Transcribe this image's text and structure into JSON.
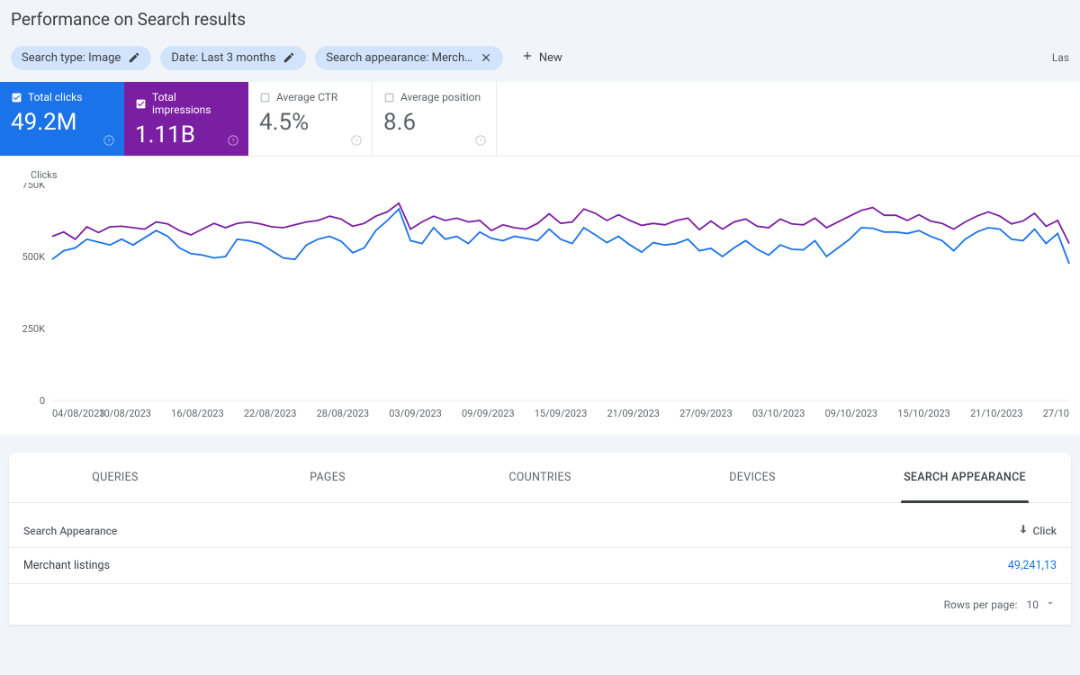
{
  "page_title": "Performance on Search results",
  "filters": {
    "search_type": "Search type: Image",
    "date": "Date: Last 3 months",
    "appearance": "Search appearance: Merch…",
    "new_label": "New"
  },
  "last_updated_fragment": "Las",
  "metrics": {
    "clicks": {
      "label": "Total clicks",
      "value": "49.2M"
    },
    "impressions": {
      "label": "Total impressions",
      "value": "1.11B"
    },
    "ctr": {
      "label": "Average CTR",
      "value": "4.5%"
    },
    "position": {
      "label": "Average position",
      "value": "8.6"
    }
  },
  "tabs": {
    "queries": "QUERIES",
    "pages": "PAGES",
    "countries": "COUNTRIES",
    "devices": "DEVICES",
    "search_appearance": "SEARCH APPEARANCE"
  },
  "table": {
    "header_name": "Search Appearance",
    "header_clicks": "Click",
    "row0_name": "Merchant listings",
    "row0_clicks": "49,241,13"
  },
  "pager": {
    "rows_label": "Rows per page:",
    "rows_value": "10"
  },
  "chart_data": {
    "type": "line",
    "ylabel": "Clicks",
    "ylim": [
      0,
      750000
    ],
    "yticks": [
      "0",
      "250K",
      "500K",
      "750K"
    ],
    "x_categories": [
      "04/08/2023",
      "10/08/2023",
      "16/08/2023",
      "22/08/2023",
      "28/08/2023",
      "03/09/2023",
      "09/09/2023",
      "15/09/2023",
      "21/09/2023",
      "27/09/2023",
      "03/10/2023",
      "09/10/2023",
      "15/10/2023",
      "21/10/2023",
      "27/10"
    ],
    "series": [
      {
        "name": "Total clicks",
        "color": "#1a73e8",
        "values": [
          490000,
          520000,
          530000,
          560000,
          550000,
          540000,
          560000,
          540000,
          565000,
          590000,
          570000,
          530000,
          510000,
          505000,
          495000,
          500000,
          560000,
          555000,
          545000,
          520000,
          495000,
          490000,
          540000,
          560000,
          570000,
          553000,
          513000,
          530000,
          590000,
          625000,
          665000,
          555000,
          545000,
          600000,
          560000,
          570000,
          545000,
          585000,
          563000,
          555000,
          570000,
          563000,
          555000,
          595000,
          560000,
          545000,
          600000,
          575000,
          548000,
          570000,
          540000,
          515000,
          548000,
          540000,
          545000,
          560000,
          520000,
          528000,
          500000,
          530000,
          555000,
          525000,
          505000,
          540000,
          525000,
          523000,
          555000,
          500000,
          530000,
          560000,
          600000,
          598000,
          585000,
          585000,
          580000,
          590000,
          570000,
          555000,
          520000,
          560000,
          585000,
          600000,
          595000,
          560000,
          555000,
          595000,
          545000,
          580000,
          475000
        ]
      },
      {
        "name": "Total impressions",
        "color": "#7b1fa2",
        "values": [
          570000,
          585000,
          560000,
          603000,
          583000,
          603000,
          605000,
          600000,
          595000,
          620000,
          613000,
          590000,
          575000,
          595000,
          615000,
          600000,
          615000,
          620000,
          613000,
          603000,
          600000,
          610000,
          620000,
          625000,
          640000,
          630000,
          605000,
          615000,
          640000,
          655000,
          685000,
          595000,
          620000,
          640000,
          625000,
          633000,
          620000,
          625000,
          590000,
          610000,
          600000,
          595000,
          615000,
          648000,
          615000,
          620000,
          665000,
          650000,
          625000,
          645000,
          625000,
          608000,
          615000,
          610000,
          625000,
          633000,
          593000,
          623000,
          595000,
          620000,
          630000,
          605000,
          600000,
          630000,
          613000,
          610000,
          633000,
          600000,
          620000,
          640000,
          660000,
          670000,
          643000,
          643000,
          625000,
          645000,
          623000,
          615000,
          595000,
          620000,
          640000,
          655000,
          640000,
          613000,
          623000,
          650000,
          605000,
          625000,
          545000
        ]
      }
    ]
  }
}
